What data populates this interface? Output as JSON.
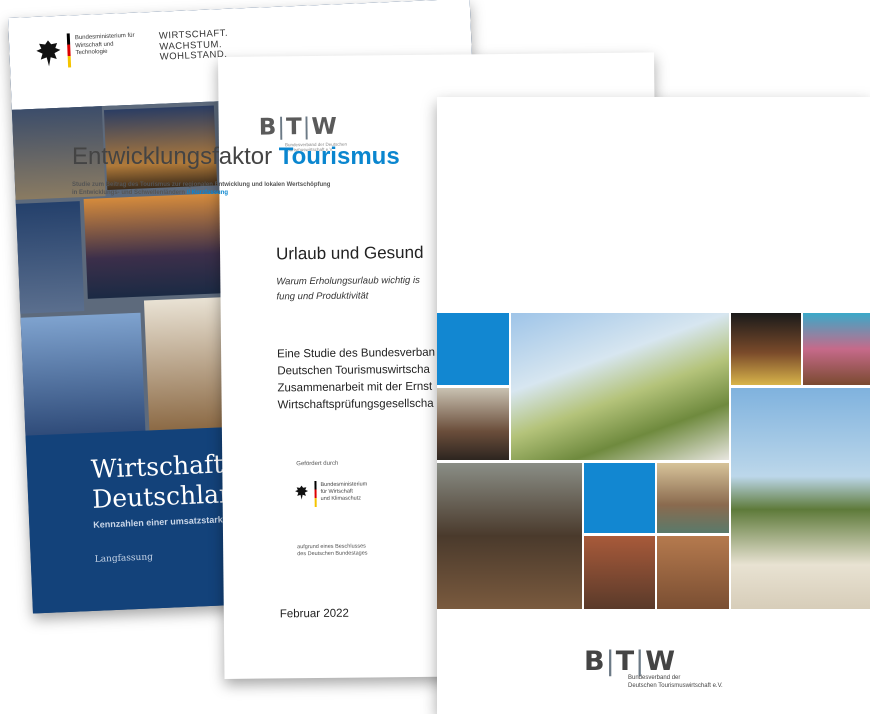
{
  "cover1": {
    "ministry": "Bundesministerium für Wirtschaft und Technologie",
    "slogan": [
      "WIRTSCHAFT.",
      "WACHSTUM.",
      "WOHLSTAND."
    ],
    "title": [
      "Wirtschaftsfak",
      "Deutschland"
    ],
    "subtitle": "Kennzahlen einer umsatzstarken Q",
    "language": "Langfassung"
  },
  "cover2": {
    "logo": {
      "b": "B",
      "t": "T",
      "w": "W",
      "sub": "Bundesverband der Deutschen Tourismuswirtschaft e.V."
    },
    "title": "Urlaub und Gesund",
    "subtitle": [
      "Warum Erholungsurlaub wichtig is",
      "fung und Produktivität"
    ],
    "study": [
      "Eine Studie des Bundesverban",
      "Deutschen Tourismuswirtscha",
      "Zusammenarbeit mit der Ernst",
      "Wirtschaftsprüfungsgesellscha"
    ],
    "funded_label": "Gefördert durch",
    "ministry": [
      "Bundesministerium",
      "für Wirtschaft",
      "und Klimaschutz"
    ],
    "resolution": [
      "aufgrund eines Beschlusses",
      "des Deutschen Bundestages"
    ],
    "date": "Februar 2022"
  },
  "cover3": {
    "title_plain": "Entwicklungsfaktor",
    "title_bold": "Tourismus",
    "subtitle_line1": "Studie zum Beitrag des Tourismus zur regionalen Entwicklung und lokalen Wertschöpfung",
    "subtitle_line2": "in Entwicklungs- und Schwellenländern",
    "subtitle_highlight": "// Kurzfassung",
    "logo": {
      "b": "B",
      "t": "T",
      "w": "W",
      "sub1": "Bundesverband der",
      "sub2": "Deutschen Tourismuswirtschaft e.V."
    },
    "accent": "#0a86cf"
  }
}
